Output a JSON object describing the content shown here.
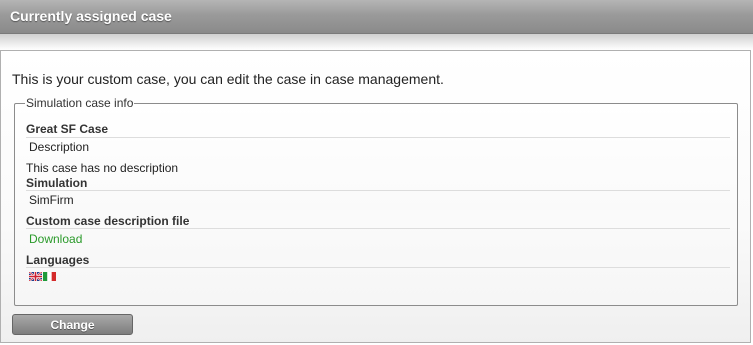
{
  "header": {
    "title": "Currently assigned case"
  },
  "intro_text": "This is your custom case, you can edit the case in case management.",
  "fieldset": {
    "legend": "Simulation case info",
    "case_name": "Great SF Case",
    "description_label": "Description",
    "description_text": "This case has no description",
    "simulation_label": "Simulation",
    "simulation_value": "SimFirm",
    "custom_file_label": "Custom case description file",
    "download_link": "Download",
    "languages_label": "Languages",
    "languages": [
      "english-flag-icon",
      "italian-flag-icon"
    ]
  },
  "actions": {
    "change_label": "Change"
  },
  "colors": {
    "link": "#2a9a2a",
    "header_bg": "#9a9a9a",
    "button_bg": "#8a8a8a"
  }
}
